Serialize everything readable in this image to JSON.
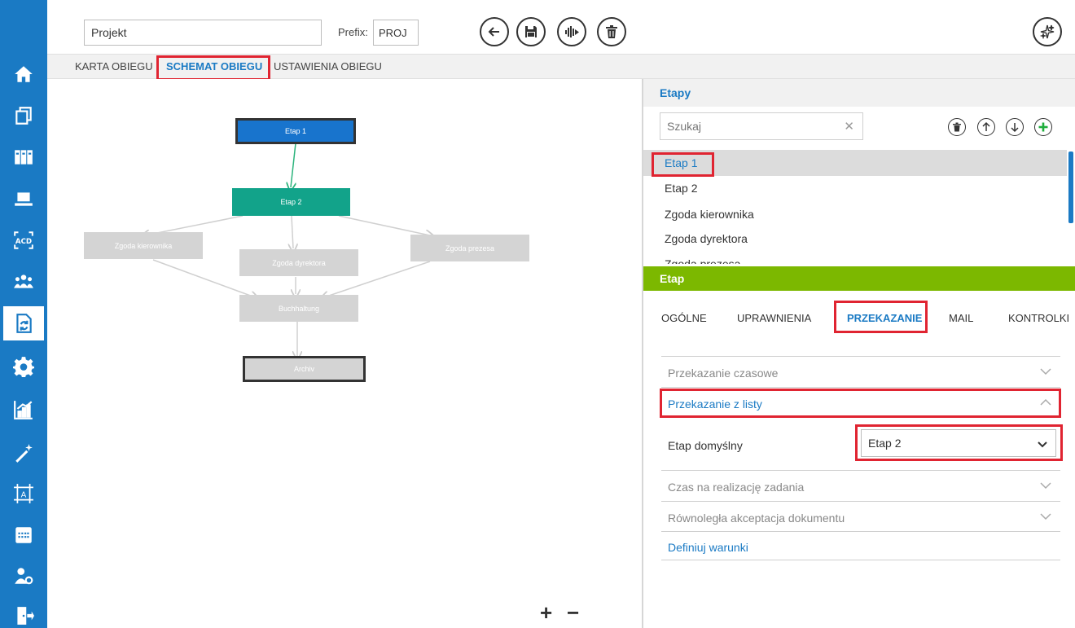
{
  "header": {
    "name_value": "Projekt",
    "prefix_label": "Prefix:",
    "prefix_value": "PROJ"
  },
  "tabs": [
    "KARTA OBIEGU",
    "SCHEMAT OBIEGU",
    "USTAWIENIA OBIEGU"
  ],
  "diagram": {
    "nodes": [
      "Etap 1",
      "Etap 2",
      "Zgoda kierownika",
      "Zgoda dyrektora",
      "Zgoda prezesa",
      "Buchhaltung",
      "Archiv"
    ],
    "zoom_in": "+",
    "zoom_out": "−"
  },
  "stages": {
    "title": "Etapy",
    "search_placeholder": "Szukaj",
    "clear": "✕",
    "items": [
      "Etap 1",
      "Etap 2",
      "Zgoda kierownika",
      "Zgoda dyrektora",
      "Zgoda prezesa"
    ]
  },
  "stage_detail": {
    "title": "Etap",
    "tabs": [
      "OGÓLNE",
      "UPRAWNIENIA",
      "PRZEKAZANIE",
      "MAIL",
      "KONTROLKI"
    ],
    "sections": [
      "Przekazanie czasowe",
      "Przekazanie z listy",
      "Czas na realizację zadania",
      "Równoległa akceptacja dokumentu"
    ],
    "default_stage_label": "Etap domyślny",
    "default_stage_value": "Etap 2",
    "define_conditions": "Definiuj warunki"
  },
  "colors": {
    "sidebar": "#1a7ac4",
    "accent": "#1a7ac4",
    "stage_header": "#7cb800",
    "node_etap1": "#1874cd",
    "node_etap2": "#12a38a",
    "node_inactive": "#d4d4d4",
    "highlight": "#e02431"
  }
}
